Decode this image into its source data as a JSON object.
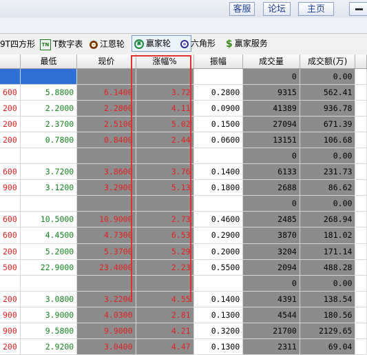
{
  "topbar": {
    "buttons": [
      "客服",
      "论坛",
      "主页"
    ]
  },
  "toolbar": {
    "items": [
      {
        "label": "9T四方形",
        "icon": "none"
      },
      {
        "label": "T数字表",
        "icon": "tn-icon"
      },
      {
        "label": "江恩轮",
        "icon": "gann-wheel-icon"
      },
      {
        "label": "赢家轮",
        "icon": "winner-wheel-icon"
      },
      {
        "label": "六角形",
        "icon": "hexagon-icon"
      },
      {
        "label": "赢家服务",
        "icon": "dollar-icon"
      }
    ],
    "tn_icon_text": "TN",
    "win_icon_text": "赢",
    "dollar_glyph": "$"
  },
  "table": {
    "columns": [
      "最低",
      "现价",
      "涨幅%",
      "振幅",
      "成交量",
      "成交额(万)"
    ],
    "rows": [
      {
        "prev": "",
        "low": "",
        "price": "",
        "change": "",
        "amp": "",
        "vol": "0",
        "amt": "0.00",
        "selected": true
      },
      {
        "prev": "600",
        "low": "5.8800",
        "price": "6.1400",
        "change": "3.72",
        "amp": "0.2800",
        "vol": "9315",
        "amt": "562.41"
      },
      {
        "prev": "200",
        "low": "2.2000",
        "price": "2.2800",
        "change": "4.11",
        "amp": "0.0900",
        "vol": "41389",
        "amt": "936.78"
      },
      {
        "prev": "200",
        "low": "2.3700",
        "price": "2.5100",
        "change": "5.02",
        "amp": "0.1500",
        "vol": "27094",
        "amt": "671.39"
      },
      {
        "prev": "200",
        "low": "0.7800",
        "price": "0.8400",
        "change": "2.44",
        "amp": "0.0600",
        "vol": "13151",
        "amt": "106.68"
      },
      {
        "prev": "",
        "low": "",
        "price": "",
        "change": "",
        "amp": "",
        "vol": "0",
        "amt": "0.00"
      },
      {
        "prev": "600",
        "low": "3.7200",
        "price": "3.8600",
        "change": "3.76",
        "amp": "0.1400",
        "vol": "6133",
        "amt": "231.73"
      },
      {
        "prev": "900",
        "low": "3.1200",
        "price": "3.2900",
        "change": "5.13",
        "amp": "0.1800",
        "vol": "2688",
        "amt": "86.62"
      },
      {
        "prev": "",
        "low": "",
        "price": "",
        "change": "",
        "amp": "",
        "vol": "0",
        "amt": "0.00"
      },
      {
        "prev": "600",
        "low": "10.5000",
        "price": "10.9000",
        "change": "2.73",
        "amp": "0.4600",
        "vol": "2485",
        "amt": "268.94"
      },
      {
        "prev": "600",
        "low": "4.4500",
        "price": "4.7300",
        "change": "6.53",
        "amp": "0.2900",
        "vol": "3870",
        "amt": "181.02"
      },
      {
        "prev": "200",
        "low": "5.2000",
        "price": "5.3700",
        "change": "5.29",
        "amp": "0.2000",
        "vol": "3204",
        "amt": "171.14"
      },
      {
        "prev": "500",
        "low": "22.9000",
        "price": "23.4000",
        "change": "2.23",
        "amp": "0.5500",
        "vol": "2094",
        "amt": "488.28"
      },
      {
        "prev": "",
        "low": "",
        "price": "",
        "change": "",
        "amp": "",
        "vol": "0",
        "amt": "0.00"
      },
      {
        "prev": "200",
        "low": "3.0800",
        "price": "3.2200",
        "change": "4.55",
        "amp": "0.1400",
        "vol": "4391",
        "amt": "138.54"
      },
      {
        "prev": "900",
        "low": "3.9000",
        "price": "4.0300",
        "change": "2.81",
        "amp": "0.1300",
        "vol": "4544",
        "amt": "180.56"
      },
      {
        "prev": "900",
        "low": "9.5800",
        "price": "9.9000",
        "change": "4.21",
        "amp": "0.3200",
        "vol": "21700",
        "amt": "2129.65"
      },
      {
        "prev": "200",
        "low": "2.9200",
        "price": "3.0400",
        "change": "4.47",
        "amp": "0.1300",
        "vol": "2311",
        "amt": "69.04"
      }
    ]
  },
  "colors": {
    "up": "#e02020",
    "down": "#13851c",
    "highlight_box": "#e03030"
  }
}
